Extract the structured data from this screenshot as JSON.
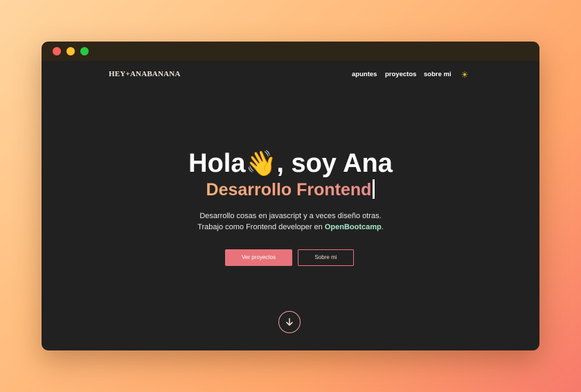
{
  "window": {
    "traffic_lights": {
      "close": "#ff6159",
      "minimize": "#ffc22e",
      "maximize": "#28c93f"
    }
  },
  "header": {
    "logo": "HEY+ANABANANA",
    "nav": [
      "apuntes",
      "proyectos",
      "sobre mi"
    ],
    "theme_toggle_icon": "sun-icon",
    "theme_toggle_glyph": "☀"
  },
  "hero": {
    "title_pre": "Hola",
    "title_emoji": "👋",
    "title_post": ", soy Ana",
    "subtitle": "Desarrollo Frontend",
    "description_line1": "Desarrollo cosas en javascript y a veces diseño otras.",
    "description_line2_pre": "Trabajo como Frontend developer en ",
    "description_brand": "OpenBootcamp",
    "description_line2_post": ".",
    "primary_button": "Ver proyectos",
    "secondary_button": "Sobre mi",
    "scroll_icon": "arrow-down-circle-icon"
  },
  "colors": {
    "accent": "#e8737a",
    "brand_green": "#a8e6cc",
    "background": "#212121"
  }
}
